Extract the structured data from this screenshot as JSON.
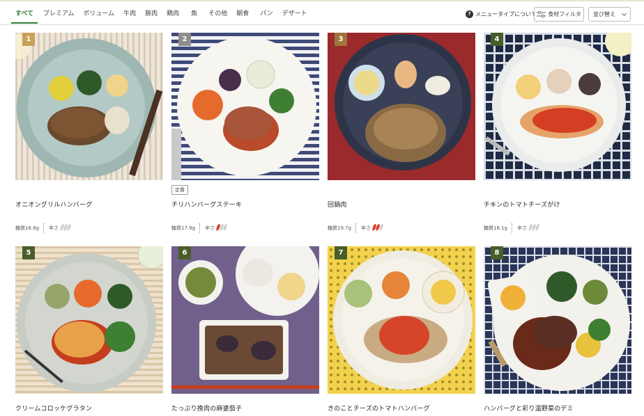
{
  "tabs": [
    {
      "label": "すべて",
      "active": true
    },
    {
      "label": "プレミアム",
      "active": false
    },
    {
      "label": "ボリューム",
      "active": false
    },
    {
      "label": "牛肉",
      "active": false
    },
    {
      "label": "豚肉",
      "active": false
    },
    {
      "label": "鶏肉",
      "active": false
    },
    {
      "label": "魚",
      "active": false
    },
    {
      "label": "その他",
      "active": false
    },
    {
      "label": "朝食",
      "active": false
    },
    {
      "label": "パン",
      "active": false
    },
    {
      "label": "デザート",
      "active": false
    }
  ],
  "toolbar": {
    "help_icon": "question-icon",
    "help_label": "メニュータイプについて",
    "filter_label": "食材フィルタ",
    "filter_icon": "filter-icon",
    "sort_label": "並び替え",
    "sort_icon": "chevron-down-icon"
  },
  "colors": {
    "accent_green": "#2e7d32",
    "badge_gold": "#c9a15b",
    "badge_gray": "#8e8e8e",
    "badge_brown": "#a0743a",
    "badge_dark_green": "#4a5e2a",
    "pepper_on": "#d9402c",
    "pepper_off": "#d2d2d2"
  },
  "menu": [
    {
      "rank": "1",
      "name": "オニオングリルハンバーグ",
      "carb_label": "糖質16.8g",
      "spicy_label": "辛さ",
      "spicy_level": 0,
      "tag": ""
    },
    {
      "rank": "2",
      "name": "チリハンバーグステーキ",
      "carb_label": "糖質17.9g",
      "spicy_label": "辛さ",
      "spicy_level": 1,
      "tag": "定番"
    },
    {
      "rank": "3",
      "name": "回鍋肉",
      "carb_label": "糖質19.7g",
      "spicy_label": "辛さ",
      "spicy_level": 2,
      "tag": ""
    },
    {
      "rank": "4",
      "name": "チキンのトマトチーズがけ",
      "carb_label": "糖質18.1g",
      "spicy_label": "辛さ",
      "spicy_level": 0,
      "tag": ""
    },
    {
      "rank": "5",
      "name": "クリームコロッケグラタン",
      "carb_label": "",
      "spicy_label": "",
      "spicy_level": 0,
      "tag": ""
    },
    {
      "rank": "6",
      "name": "たっぷり挽肉の麻婆茄子",
      "carb_label": "",
      "spicy_label": "",
      "spicy_level": 0,
      "tag": ""
    },
    {
      "rank": "7",
      "name": "きのことチーズのトマトハンバーグ",
      "carb_label": "",
      "spicy_label": "",
      "spicy_level": 0,
      "tag": ""
    },
    {
      "rank": "8",
      "name": "ハンバーグと彩り温野菜のデミ",
      "carb_label": "",
      "spicy_label": "",
      "spicy_level": 0,
      "tag": ""
    }
  ]
}
